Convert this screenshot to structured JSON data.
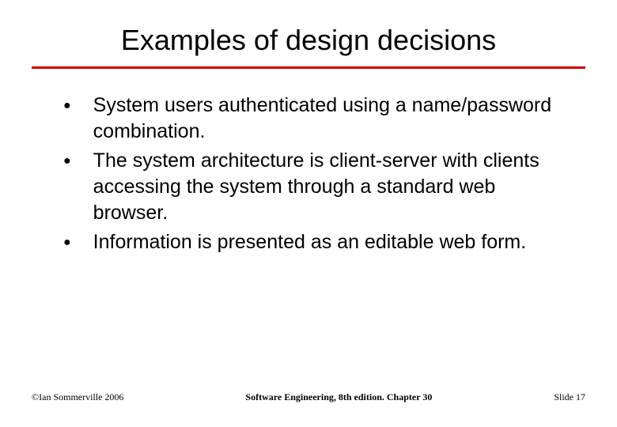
{
  "title": "Examples of design decisions",
  "bullets": [
    "System users authenticated using a name/password combination.",
    "The system architecture is client-server with clients accessing the system through a standard web browser.",
    "Information is presented as an editable web form."
  ],
  "footer": {
    "left": "©Ian Sommerville 2006",
    "center": "Software Engineering, 8th edition. Chapter 30",
    "right": "Slide 17"
  }
}
